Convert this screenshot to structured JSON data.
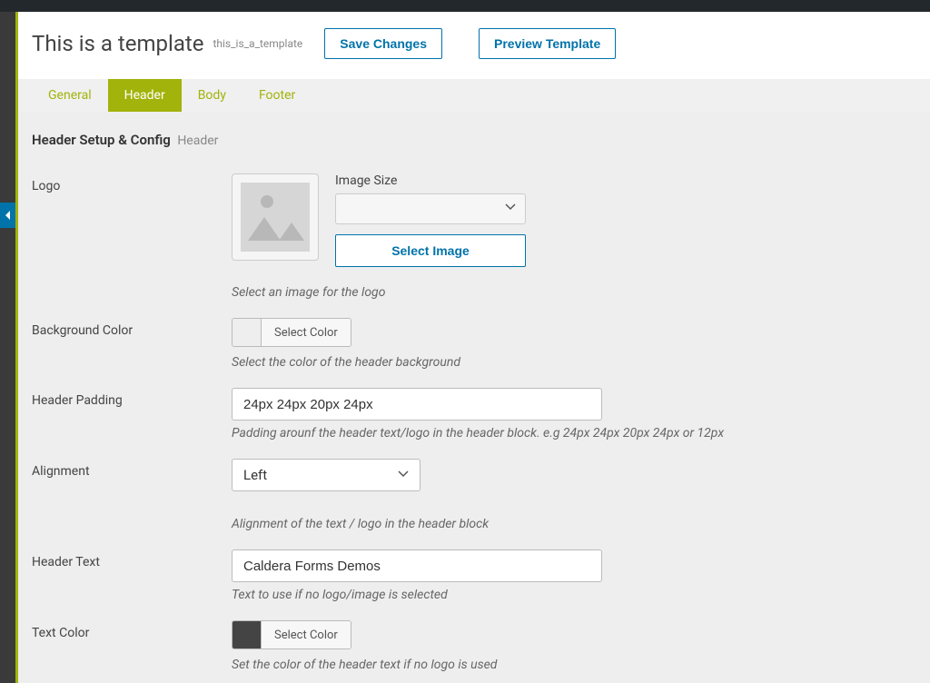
{
  "header": {
    "title": "This is a template",
    "slug": "this_is_a_template",
    "save_label": "Save Changes",
    "preview_label": "Preview Template"
  },
  "tabs": [
    {
      "label": "General"
    },
    {
      "label": "Header"
    },
    {
      "label": "Body"
    },
    {
      "label": "Footer"
    }
  ],
  "active_tab": "Header",
  "section": {
    "title": "Header Setup & Config",
    "subtitle": "Header"
  },
  "fields": {
    "logo": {
      "label": "Logo",
      "image_size_label": "Image Size",
      "image_size_value": "",
      "select_image_label": "Select Image",
      "helper": "Select an image for the logo"
    },
    "bgcolor": {
      "label": "Background Color",
      "button_label": "Select Color",
      "swatch": "#eeeeee",
      "helper": "Select the color of the header background"
    },
    "padding": {
      "label": "Header Padding",
      "value": "24px 24px 20px 24px",
      "helper": "Padding arounf the header text/logo in the header block. e.g 24px 24px 20px 24px or 12px"
    },
    "alignment": {
      "label": "Alignment",
      "value": "Left",
      "helper": "Alignment of the text / logo in the header block"
    },
    "header_text": {
      "label": "Header Text",
      "value": "Caldera Forms Demos",
      "helper": "Text to use if no logo/image is selected"
    },
    "text_color": {
      "label": "Text Color",
      "button_label": "Select Color",
      "swatch": "#444444",
      "helper": "Set the color of the header text if no logo is used"
    }
  }
}
